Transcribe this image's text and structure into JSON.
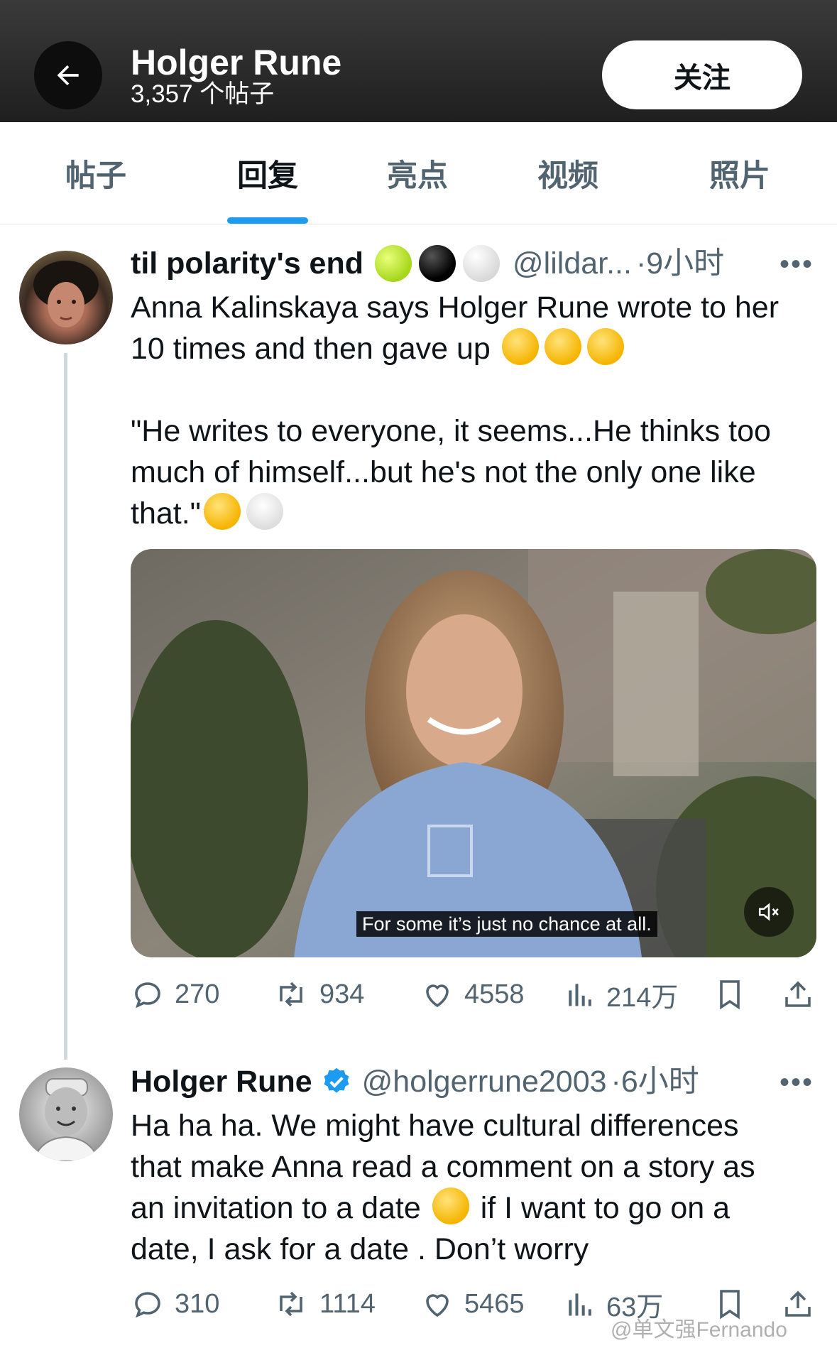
{
  "header": {
    "title": "Holger Rune",
    "post_count": "3,357 个帖子",
    "follow_label": "关注"
  },
  "tabs": [
    {
      "label": "帖子",
      "active": false
    },
    {
      "label": "回复",
      "active": true
    },
    {
      "label": "亮点",
      "active": false
    },
    {
      "label": "视频",
      "active": false
    },
    {
      "label": "照片",
      "active": false
    }
  ],
  "tweets": [
    {
      "display_name": "til polarity's end",
      "handle": "@lildar...",
      "time": "·9小时",
      "text_line1": "Anna Kalinskaya says Holger Rune wrote to her",
      "text_line2": "10 times and then gave up",
      "text_line3": "\"He writes to everyone, it seems...He thinks too",
      "text_line4": "much of himself...but he's not the only one like",
      "text_line5": "that.\"",
      "video_caption": "For some it’s just no chance at all.",
      "replies": "270",
      "reposts": "934",
      "likes": "4558",
      "views": "214万"
    },
    {
      "display_name": "Holger Rune",
      "handle": "@holgerrune2003",
      "time": "·6小时",
      "text_line1": "Ha ha ha. We might have cultural differences",
      "text_line2": "that make Anna read a comment on a story as",
      "text_line3a": "an invitation to a date",
      "text_line3b": " if I want to go on a",
      "text_line4": "date, I ask for a date . Don’t worry",
      "replies": "310",
      "reposts": "1114",
      "likes": "5465",
      "views": "63万"
    }
  ],
  "watermark": "@单文强Fernando",
  "colors": {
    "accent": "#1d9bf0",
    "text": "#0f1419",
    "muted": "#536471"
  }
}
